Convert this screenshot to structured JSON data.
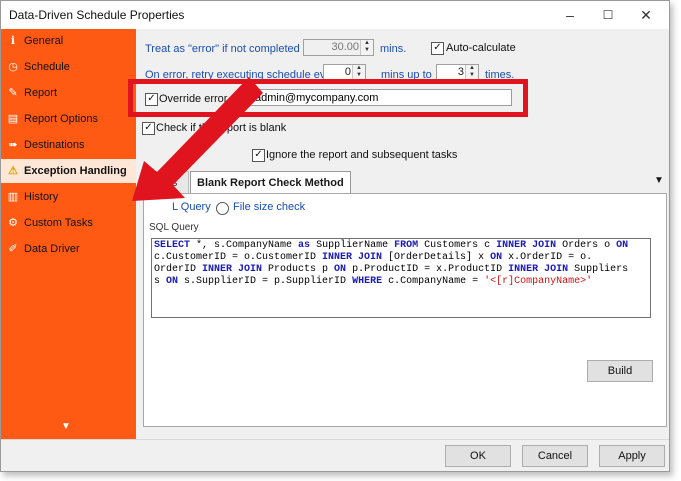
{
  "window": {
    "title": "Data-Driven Schedule Properties",
    "controls": {
      "minimize": "–",
      "maximize": "☐",
      "close": "✕"
    }
  },
  "sidebar": {
    "items": [
      {
        "label": "General",
        "icon": "info-icon",
        "glyph": "ℹ"
      },
      {
        "label": "Schedule",
        "icon": "clock-icon",
        "glyph": "◷"
      },
      {
        "label": "Report",
        "icon": "report-pen-icon",
        "glyph": "✎"
      },
      {
        "label": "Report Options",
        "icon": "report-options-icon",
        "glyph": "▤"
      },
      {
        "label": "Destinations",
        "icon": "destinations-icon",
        "glyph": "➠"
      },
      {
        "label": "Exception Handling",
        "icon": "warning-icon",
        "glyph": "⚠"
      },
      {
        "label": "History",
        "icon": "history-icon",
        "glyph": "▥"
      },
      {
        "label": "Custom Tasks",
        "icon": "custom-tasks-icon",
        "glyph": "⚙"
      },
      {
        "label": "Data Driver",
        "icon": "data-driver-icon",
        "glyph": "✐"
      }
    ],
    "active_index": 5,
    "scroll_down": "▼"
  },
  "exception": {
    "treat_as_error_label": "Treat as \"error\" if not completed in",
    "treat_minutes": "30.00",
    "mins_label": "mins.",
    "auto_calc_label": "Auto-calculate",
    "auto_calc_checked": true,
    "retry_label": "On error, retry executing schedule every",
    "retry_every": "0",
    "mins_up_to_label": "mins up to",
    "retry_times": "3",
    "times_label": "times.",
    "override_label": "Override error email:",
    "override_checked": true,
    "override_email": "admin@mycompany.com",
    "check_blank_label": "Check if the report is blank",
    "check_blank_checked": true,
    "ignore_label": "Ignore the report and subsequent tasks",
    "ignore_checked": true
  },
  "tabs": {
    "items": [
      "Notifications",
      "Blank Report Check Method"
    ],
    "inactive_visible": "ations",
    "active_index": 1,
    "dropdown_glyph": "▼"
  },
  "blank_check": {
    "radio_sql_label": "SQL Query",
    "radio_sql_visible": "L Query",
    "radio_file_label": "File size check",
    "selected": "sql",
    "sql_section_label": "SQL Query",
    "sql_lines": [
      "SELECT *, s.CompanyName as SupplierName FROM Customers c INNER JOIN Orders o ON",
      "c.CustomerID = o.CustomerID INNER JOIN [OrderDetails] x ON x.OrderID = o.",
      "OrderID INNER JOIN Products p ON p.ProductID = x.ProductID INNER JOIN Suppliers",
      "s ON s.SupplierID = p.SupplierID WHERE c.CompanyName = '<[r]CompanyName>'"
    ],
    "build_label": "Build"
  },
  "footer": {
    "ok_label": "OK",
    "cancel_label": "Cancel",
    "apply_label": "Apply"
  },
  "colors": {
    "sidebar_bg": "#ff5a14",
    "highlight": "#e0141e",
    "sql_keyword": "#1a1ab4",
    "sql_string": "#d01010"
  }
}
